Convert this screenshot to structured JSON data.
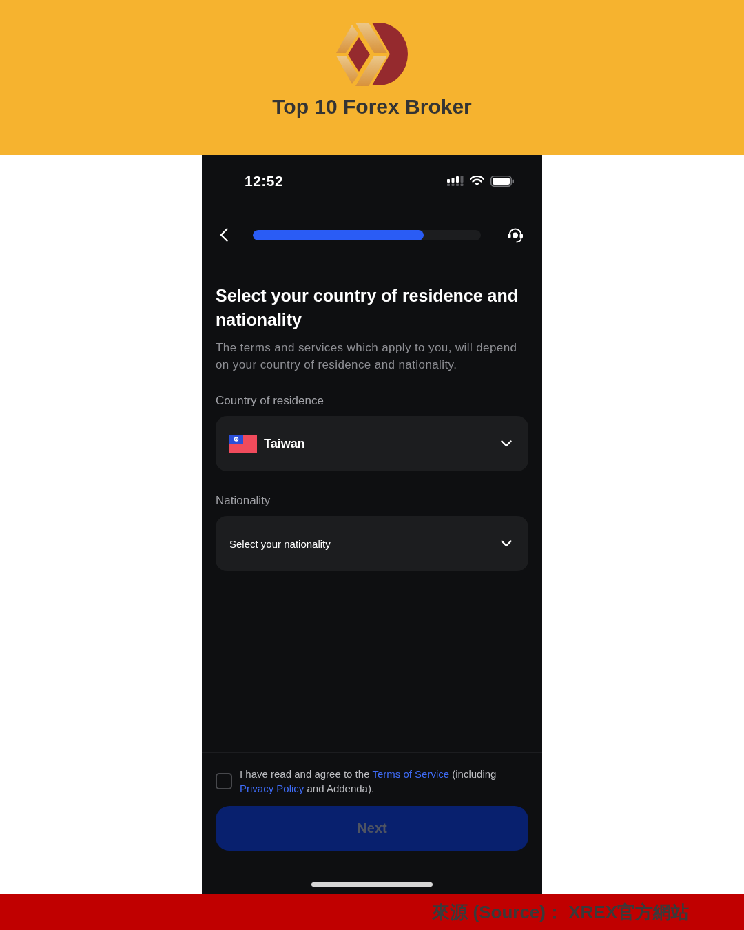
{
  "banner": {
    "title": "Top 10 Forex Broker"
  },
  "status_bar": {
    "time": "12:52"
  },
  "nav": {
    "progress": {
      "level": 0.75
    }
  },
  "heading": "Select your country of residence and nationality",
  "description": "The terms and services which apply to you, will depend on your country of residence and nationality.",
  "fields": [
    {
      "label": "Country of residence",
      "value": "Taiwan"
    },
    {
      "label": "Nationality",
      "placeholder": "Select your nationality"
    }
  ],
  "agreement": {
    "checked": false,
    "parts": [
      {
        "kind": "text",
        "text": "I have read and agree to the "
      },
      {
        "kind": "link",
        "text": "Terms of Service"
      },
      {
        "kind": "text",
        "text": " (including "
      },
      {
        "kind": "link",
        "text": "Privacy Policy"
      },
      {
        "kind": "text",
        "text": " and Addenda)."
      }
    ]
  },
  "next_button": {
    "label": "Next",
    "disabled": true
  },
  "source_caption": "來源 (Source)： XREX官方網站"
}
